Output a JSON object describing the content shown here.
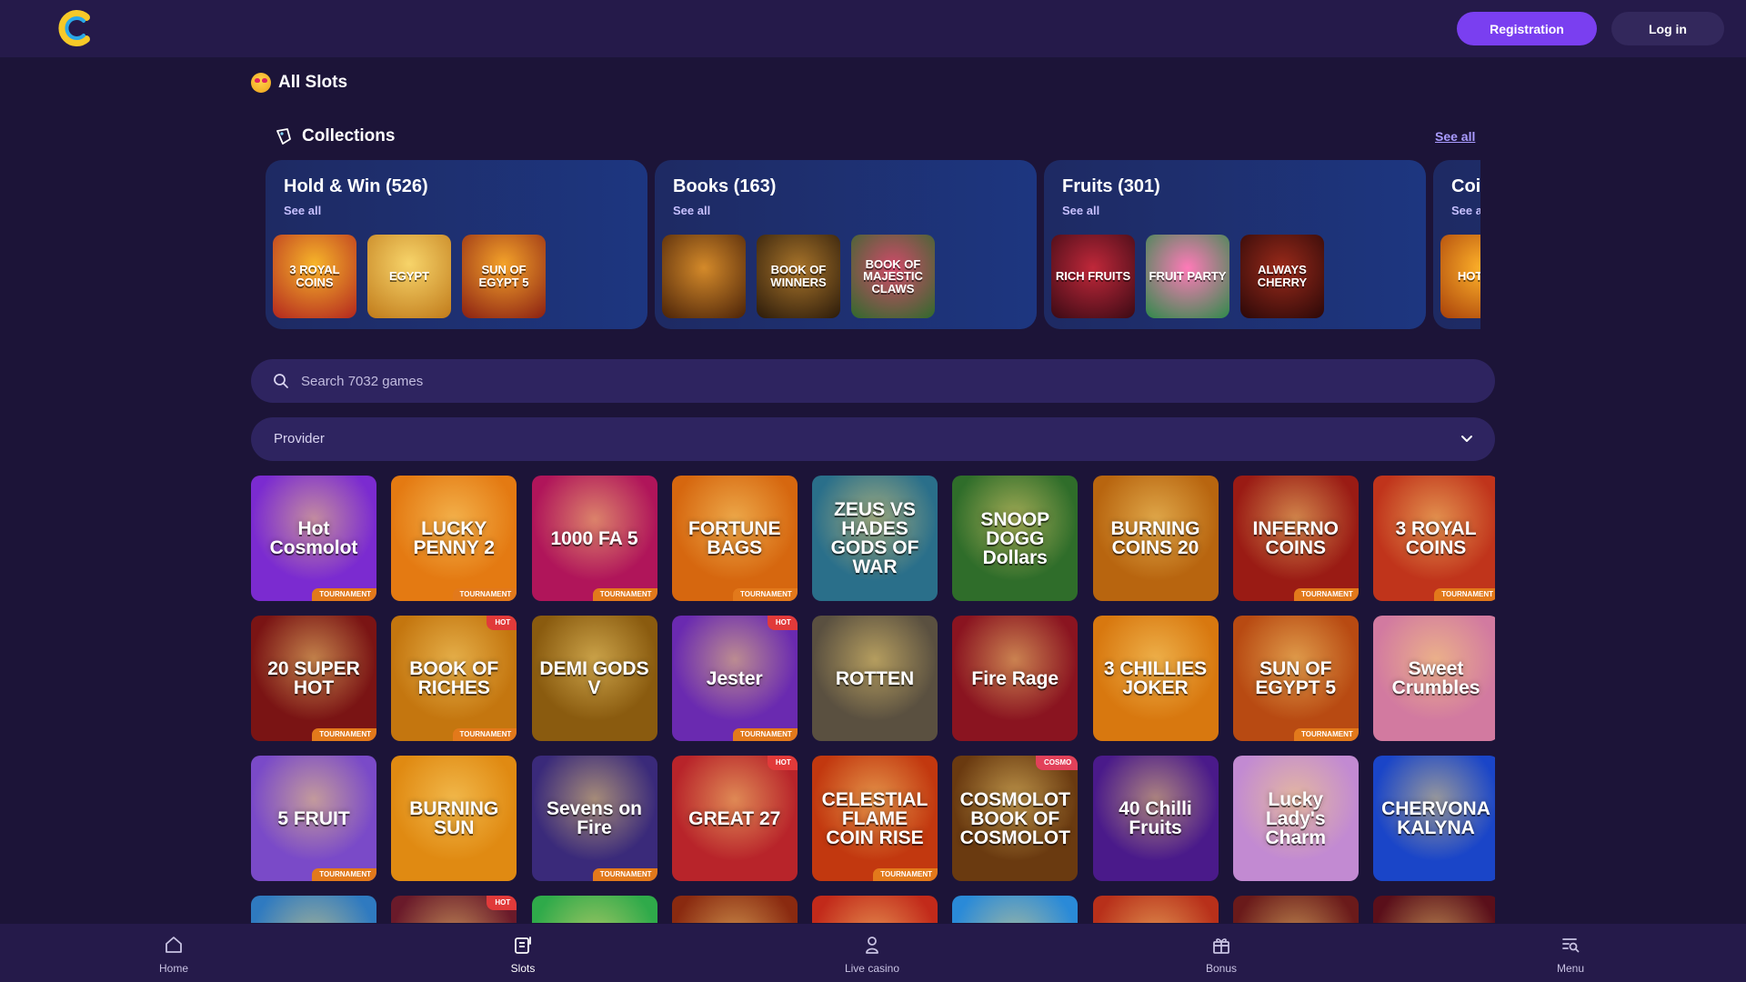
{
  "header": {
    "registration_label": "Registration",
    "login_label": "Log in"
  },
  "page": {
    "title": "All Slots"
  },
  "collections": {
    "heading": "Collections",
    "see_all": "See all",
    "cards": [
      {
        "title": "Hold & Win (526)",
        "see_all": "See all",
        "thumbs": [
          {
            "label": "3 ROYAL COINS",
            "color": "#b3261e"
          },
          {
            "label": "EGYPT",
            "color": "#e0a53a"
          },
          {
            "label": "SUN OF EGYPT 5",
            "color": "#c0471f"
          }
        ]
      },
      {
        "title": "Books (163)",
        "see_all": "See all",
        "thumbs": [
          {
            "label": "",
            "color": "#8a4a12"
          },
          {
            "label": "BOOK OF WINNERS",
            "color": "#4a3214"
          },
          {
            "label": "BOOK OF MAJESTIC CLAWS",
            "color": "#2f6a2c"
          }
        ]
      },
      {
        "title": "Fruits (301)",
        "see_all": "See all",
        "thumbs": [
          {
            "label": "RICH FRUITS",
            "color": "#5a1020"
          },
          {
            "label": "FRUIT PARTY",
            "color": "#4aa35a"
          },
          {
            "label": "ALWAYS CHERRY",
            "color": "#5b1a16"
          }
        ]
      },
      {
        "title": "Coi",
        "see_all": "See a",
        "thumbs": [
          {
            "label": "HOT COI",
            "color": "#d66a12"
          }
        ]
      }
    ]
  },
  "search": {
    "placeholder": "Search 7032 games"
  },
  "provider": {
    "label": "Provider"
  },
  "games": [
    {
      "label": "Hot Cosmolot",
      "color": "#7b2bd0",
      "badge": "tournament",
      "top": ""
    },
    {
      "label": "LUCKY PENNY 2",
      "color": "#e47a12",
      "badge": "tournament",
      "top": ""
    },
    {
      "label": "1000 FA 5",
      "color": "#b0155a",
      "badge": "tournament",
      "top": ""
    },
    {
      "label": "FORTUNE BAGS",
      "color": "#d6670f",
      "badge": "tournament",
      "top": ""
    },
    {
      "label": "ZEUS VS HADES GODS OF WAR",
      "color": "#2a6f8a",
      "badge": "",
      "top": ""
    },
    {
      "label": "SNOOP DOGG Dollars",
      "color": "#2f6d2a",
      "badge": "",
      "top": ""
    },
    {
      "label": "BURNING COINS 20",
      "color": "#b8650f",
      "badge": "",
      "top": ""
    },
    {
      "label": "INFERNO COINS",
      "color": "#9a1b14",
      "badge": "tournament",
      "top": ""
    },
    {
      "label": "3 ROYAL COINS",
      "color": "#c0341b",
      "badge": "tournament",
      "top": ""
    },
    {
      "label": "20 SUPER HOT",
      "color": "#7a1414",
      "badge": "tournament",
      "top": ""
    },
    {
      "label": "BOOK OF RICHES",
      "color": "#c4760f",
      "badge": "tournament",
      "top": "hot"
    },
    {
      "label": "DEMI GODS V",
      "color": "#8a5b0f",
      "badge": "",
      "top": ""
    },
    {
      "label": "Jester",
      "color": "#6a2ab0",
      "badge": "tournament",
      "top": "hot"
    },
    {
      "label": "ROTTEN",
      "color": "#5a5040",
      "badge": "",
      "top": ""
    },
    {
      "label": "Fire Rage",
      "color": "#8a1420",
      "badge": "",
      "top": ""
    },
    {
      "label": "3 CHILLIES JOKER",
      "color": "#d8780f",
      "badge": "",
      "top": ""
    },
    {
      "label": "SUN OF EGYPT 5",
      "color": "#b84a12",
      "badge": "tournament",
      "top": ""
    },
    {
      "label": "Sweet Crumbles",
      "color": "#d27aa0",
      "badge": "",
      "top": ""
    },
    {
      "label": "5 FRUIT",
      "color": "#7a4ac8",
      "badge": "tournament",
      "top": ""
    },
    {
      "label": "BURNING SUN",
      "color": "#e08a12",
      "badge": "",
      "top": ""
    },
    {
      "label": "Sevens on Fire",
      "color": "#3a2a7a",
      "badge": "tournament",
      "top": ""
    },
    {
      "label": "GREAT 27",
      "color": "#b8242a",
      "badge": "",
      "top": "hot"
    },
    {
      "label": "CELESTIAL FLAME COIN RISE",
      "color": "#c2380f",
      "badge": "tournament",
      "top": ""
    },
    {
      "label": "COSMOLOT BOOK OF COSMOLOT",
      "color": "#6a3a10",
      "badge": "",
      "top": "cosmo"
    },
    {
      "label": "40 Chilli Fruits",
      "color": "#4a1a8a",
      "badge": "",
      "top": ""
    },
    {
      "label": "Lucky Lady's Charm",
      "color": "#c28ad2",
      "badge": "",
      "top": ""
    },
    {
      "label": "CHERVONA KALYNA",
      "color": "#1a45c8",
      "badge": "",
      "top": ""
    },
    {
      "label": "",
      "color": "#2f7ac0",
      "badge": "",
      "top": ""
    },
    {
      "label": "",
      "color": "#6a1a2a",
      "badge": "",
      "top": "hot"
    },
    {
      "label": "",
      "color": "#2faa4a",
      "badge": "",
      "top": ""
    },
    {
      "label": "",
      "color": "#8a2a10",
      "badge": "",
      "top": ""
    },
    {
      "label": "",
      "color": "#c22a1a",
      "badge": "",
      "top": ""
    },
    {
      "label": "",
      "color": "#2a8ad8",
      "badge": "",
      "top": ""
    },
    {
      "label": "",
      "color": "#b8301a",
      "badge": "",
      "top": ""
    },
    {
      "label": "",
      "color": "#6a1a1a",
      "badge": "",
      "top": ""
    },
    {
      "label": "",
      "color": "#5a0f1a",
      "badge": "",
      "top": ""
    }
  ],
  "badges": {
    "tournament": "TOURNAMENT",
    "hot": "HOT",
    "cosmo": "COSMO"
  },
  "bottom_nav": [
    {
      "label": "Home",
      "icon": "home-icon"
    },
    {
      "label": "Slots",
      "icon": "slots-icon"
    },
    {
      "label": "Live casino",
      "icon": "live-casino-icon"
    },
    {
      "label": "Bonus",
      "icon": "gift-icon"
    },
    {
      "label": "Menu",
      "icon": "menu-search-icon"
    }
  ],
  "colors": {
    "background": "#1c1438",
    "bar": "#251a4a",
    "accent": "#7a3ff0",
    "field": "#2e2460"
  }
}
